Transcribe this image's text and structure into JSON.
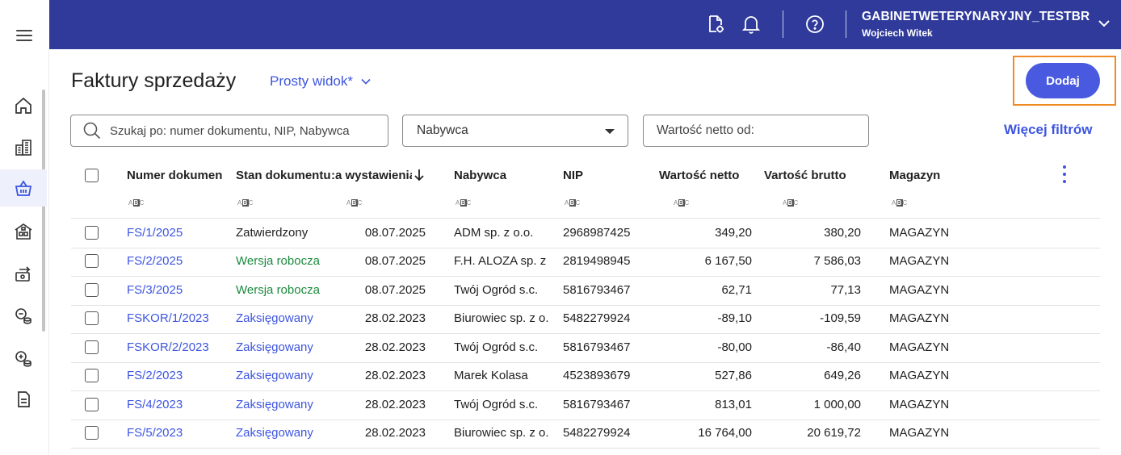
{
  "topbar": {
    "company": "GABINETWETERYNARYJNY_TESTBR",
    "user": "Wojciech Witek",
    "icons": [
      "document-settings-icon",
      "bell-icon",
      "help-icon",
      "chevron-down-icon"
    ]
  },
  "sidebar": {
    "items": [
      "home-icon",
      "building-icon",
      "basket-icon",
      "warehouse-icon",
      "money-transfer-icon",
      "coins-minus-icon",
      "coins-plus-icon",
      "document-icon"
    ],
    "active_index": 2
  },
  "header": {
    "title": "Faktury sprzedaży",
    "view_label": "Prosty widok*",
    "add_label": "Dodaj"
  },
  "filters": {
    "search_placeholder": "Szukaj po: numer dokumentu, NIP, Nabywca",
    "buyer_label": "Nabywca",
    "net_from_placeholder": "Wartość netto od:",
    "more_label": "Więcej filtrów"
  },
  "table": {
    "columns": [
      "Numer dokument",
      "Stan dokumentu",
      ":a wystawienia",
      "Nabywca",
      "NIP",
      "Wartość netto",
      "Vartość brutto",
      "Magazyn"
    ],
    "abc_left": "A",
    "abc_mid": "B",
    "abc_right": "C",
    "rows": [
      {
        "number": "FS/1/2025",
        "status": "Zatwierdzony",
        "status_type": "approved",
        "date": "08.07.2025",
        "buyer": "ADM sp. z o.o.",
        "nip": "2968987425",
        "net": "349,20",
        "gross": "380,20",
        "warehouse": "MAGAZYN"
      },
      {
        "number": "FS/2/2025",
        "status": "Wersja robocza",
        "status_type": "draft",
        "date": "08.07.2025",
        "buyer": "F.H. ALOZA sp. z",
        "nip": "2819498945",
        "net": "6 167,50",
        "gross": "7 586,03",
        "warehouse": "MAGAZYN"
      },
      {
        "number": "FS/3/2025",
        "status": "Wersja robocza",
        "status_type": "draft",
        "date": "08.07.2025",
        "buyer": "Twój Ogród s.c.",
        "nip": "5816793467",
        "net": "62,71",
        "gross": "77,13",
        "warehouse": "MAGAZYN"
      },
      {
        "number": "FSKOR/1/2023",
        "status": "Zaksięgowany",
        "status_type": "posted",
        "date": "28.02.2023",
        "buyer": "Biurowiec sp. z o.",
        "nip": "5482279924",
        "net": "-89,10",
        "gross": "-109,59",
        "warehouse": "MAGAZYN"
      },
      {
        "number": "FSKOR/2/2023",
        "status": "Zaksięgowany",
        "status_type": "posted",
        "date": "28.02.2023",
        "buyer": "Twój Ogród s.c.",
        "nip": "5816793467",
        "net": "-80,00",
        "gross": "-86,40",
        "warehouse": "MAGAZYN"
      },
      {
        "number": "FS/2/2023",
        "status": "Zaksięgowany",
        "status_type": "posted",
        "date": "28.02.2023",
        "buyer": "Marek Kolasa",
        "nip": "4523893679",
        "net": "527,86",
        "gross": "649,26",
        "warehouse": "MAGAZYN"
      },
      {
        "number": "FS/4/2023",
        "status": "Zaksięgowany",
        "status_type": "posted",
        "date": "28.02.2023",
        "buyer": "Twój Ogród s.c.",
        "nip": "5816793467",
        "net": "813,01",
        "gross": "1 000,00",
        "warehouse": "MAGAZYN"
      },
      {
        "number": "FS/5/2023",
        "status": "Zaksięgowany",
        "status_type": "posted",
        "date": "28.02.2023",
        "buyer": "Biurowiec sp. z o.",
        "nip": "5482279924",
        "net": "16 764,00",
        "gross": "20 619,72",
        "warehouse": "MAGAZYN"
      }
    ]
  },
  "colors": {
    "topbar": "#2f3a9b",
    "accent": "#3d55e0",
    "button": "#4a5ae0",
    "draft": "#1a8a3c",
    "highlight": "#f08a24"
  }
}
